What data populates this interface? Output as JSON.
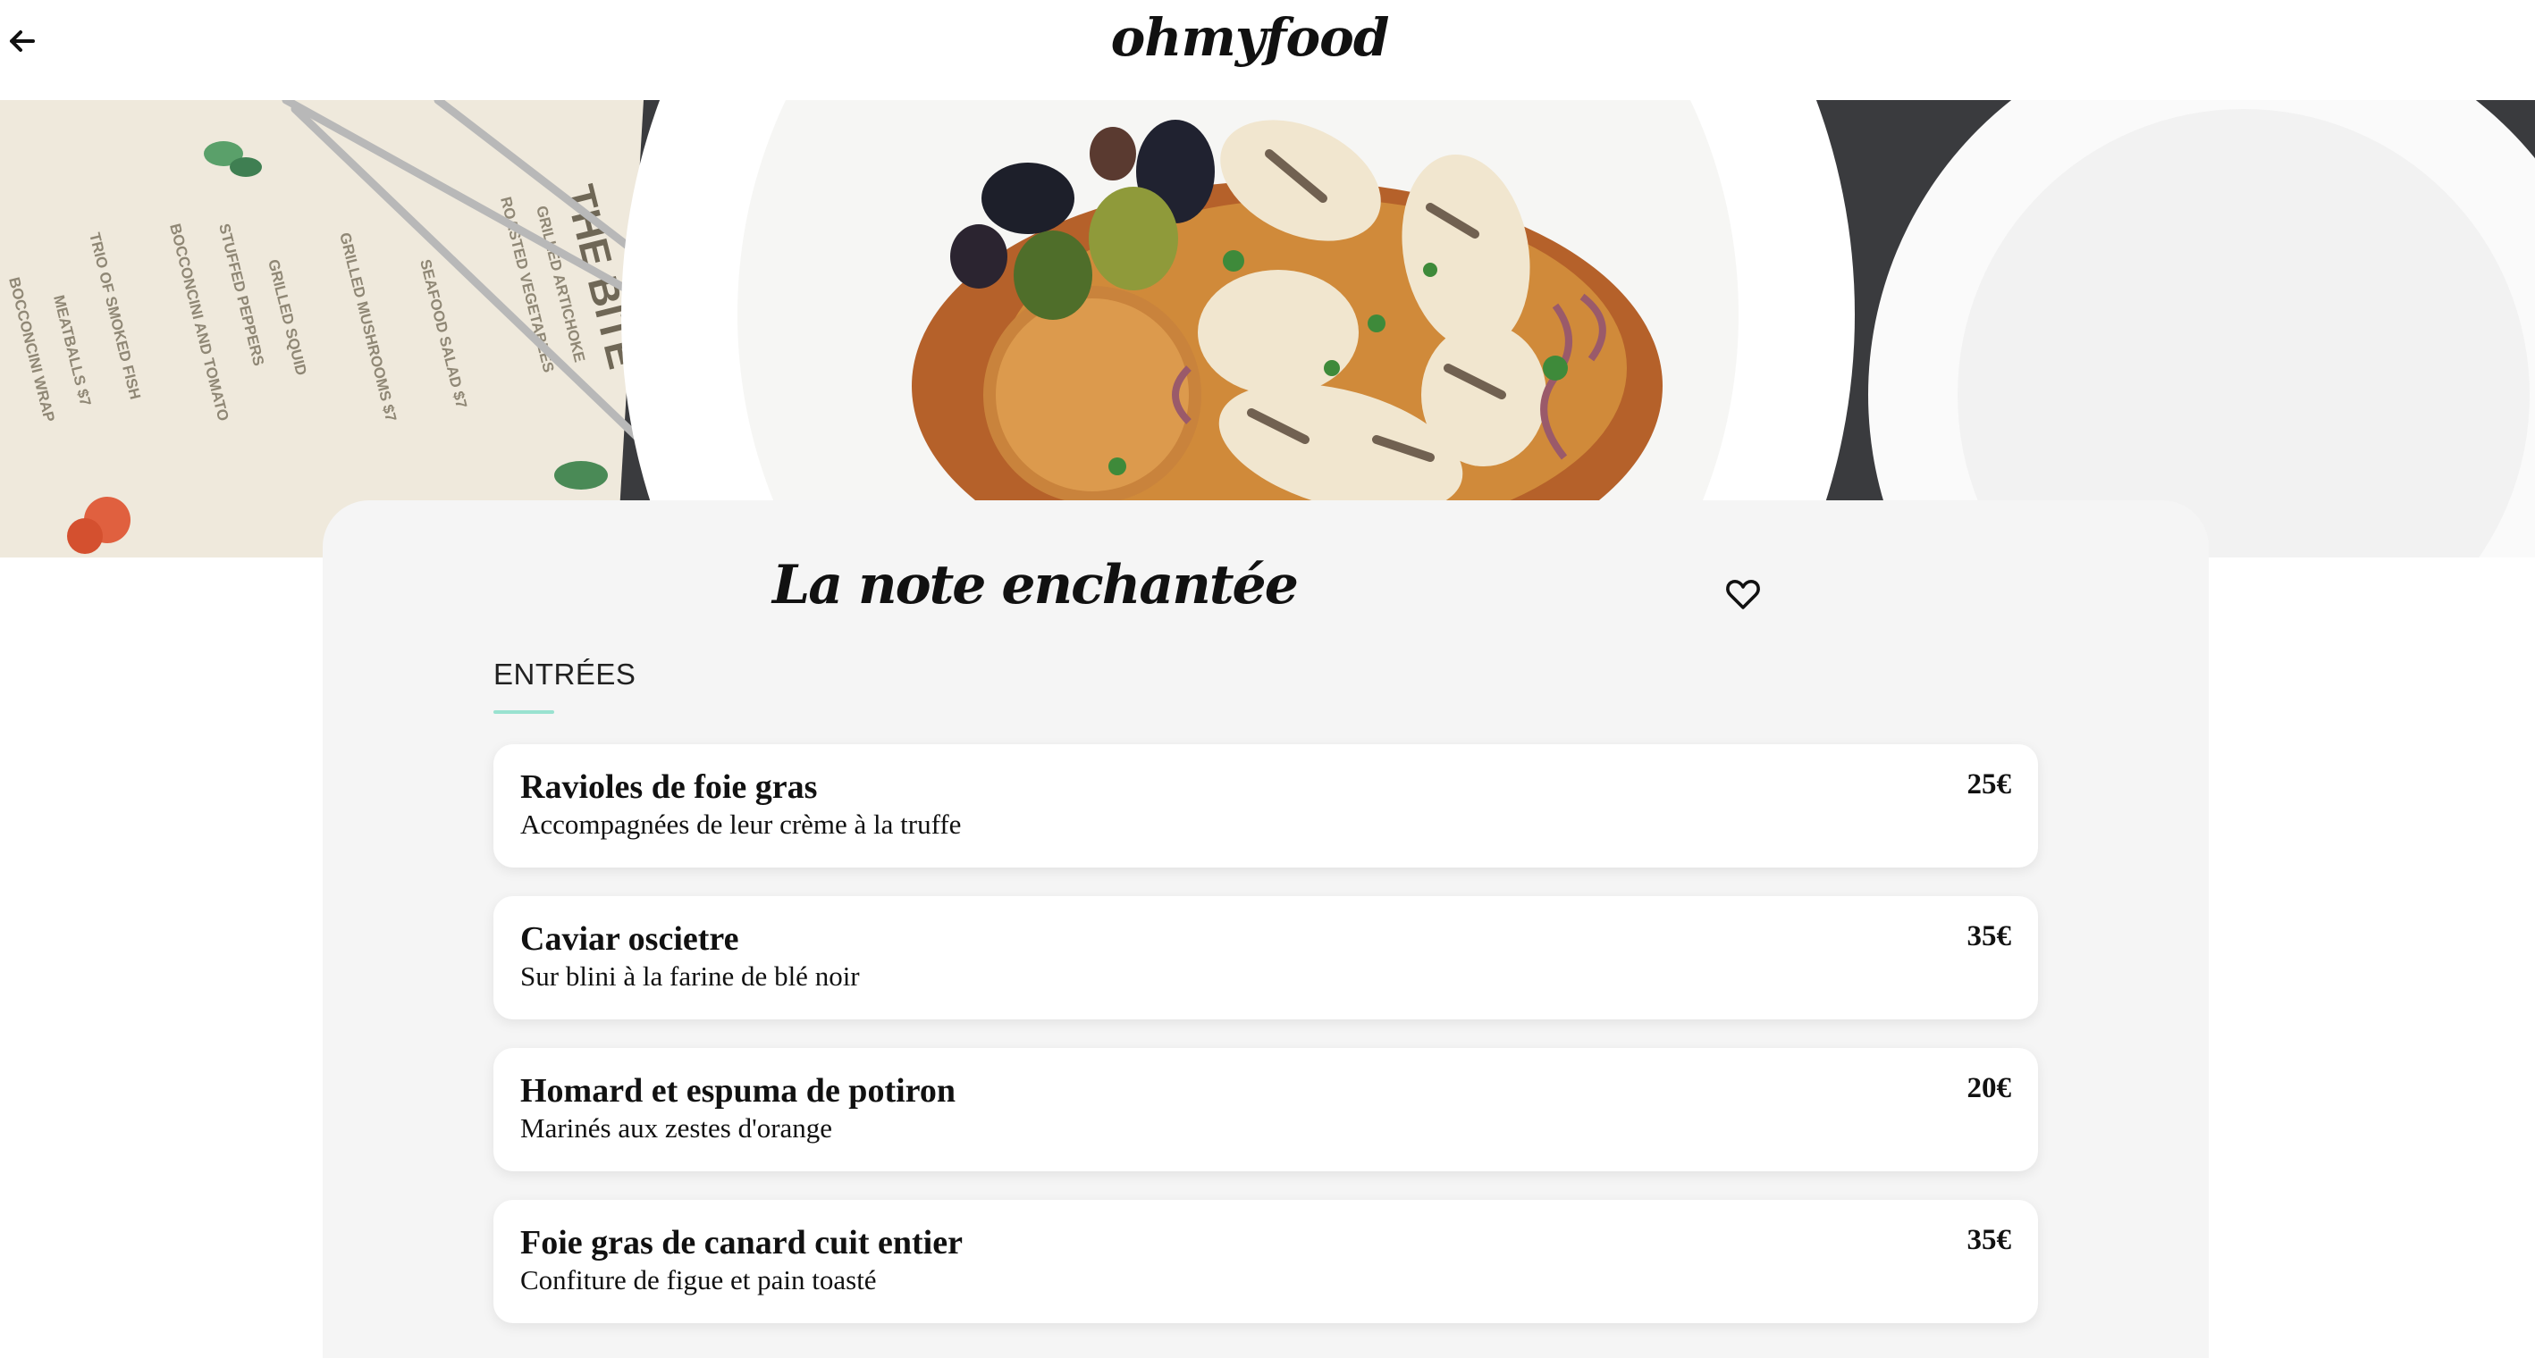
{
  "header": {
    "logo": "ohmyfood",
    "back_icon": "arrow-left-icon"
  },
  "hero": {
    "image": "restaurant-dish-photo",
    "menu_fragments": [
      "THE BITE",
      "GRILLED ARTICHOKE",
      "ROASTED VEGETABLES",
      "SEAFOOD SALAD $7",
      "GRILLED MUSHROOMS $7",
      "GRILLED SQUID",
      "STUFFED PEPPERS",
      "BOCCONCINI AND TOMATO",
      "TRIO OF SMOKED FISH",
      "MEATBALLS $7",
      "BOCCONCINI WRAP"
    ]
  },
  "restaurant": {
    "name": "La note enchantée",
    "favorite_icon": "heart-outline-icon"
  },
  "section": {
    "title": "ENTRÉES",
    "accent_color": "#99e2d0"
  },
  "dishes": [
    {
      "name": "Ravioles de foie gras",
      "description": "Accompagnées de leur crème à la truffe",
      "price": "25€"
    },
    {
      "name": "Caviar oscietre",
      "description": "Sur blini à la farine de blé noir",
      "price": "35€"
    },
    {
      "name": "Homard et espuma de potiron",
      "description": "Marinés aux zestes d'orange",
      "price": "20€"
    },
    {
      "name": "Foie gras de canard cuit entier",
      "description": "Confiture de figue et pain toasté",
      "price": "35€"
    }
  ]
}
